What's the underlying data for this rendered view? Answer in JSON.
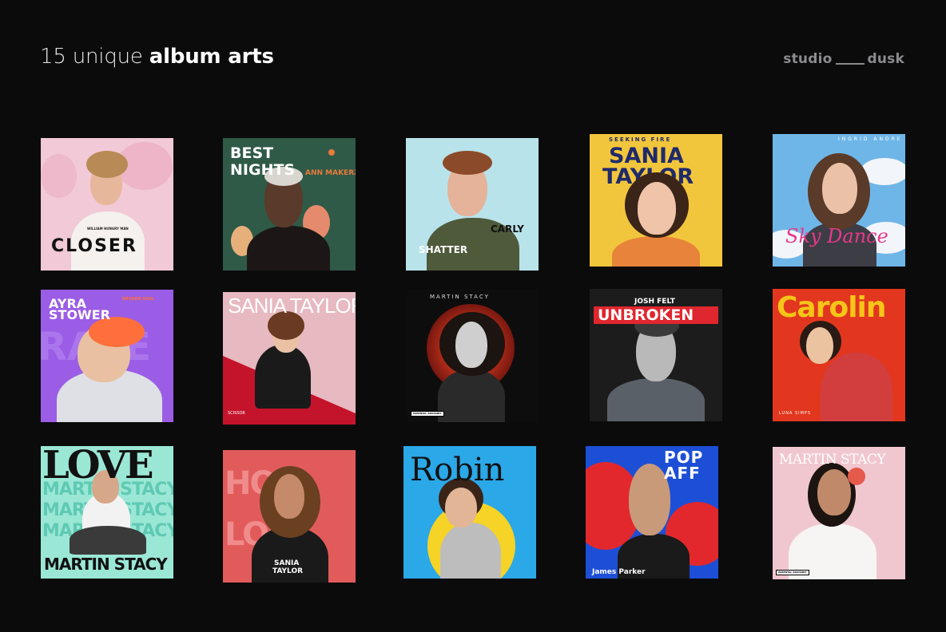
{
  "header": {
    "title_light": "15 unique ",
    "title_bold": "album arts",
    "brand_left": "studio",
    "brand_right": "dusk"
  },
  "covers": [
    {
      "id": 1,
      "texts": {
        "main": "CLOSER",
        "small": "WILLIAM HUNGRY MAN"
      },
      "colors": {
        "bg": "#f2c9d6"
      }
    },
    {
      "id": 2,
      "texts": {
        "l1": "BEST",
        "l2": "NIGHTS",
        "artist": "ANN MAKERZ"
      },
      "colors": {
        "bg": "#2f5a47",
        "accent": "#e87a3c"
      }
    },
    {
      "id": 3,
      "texts": {
        "a": "CARLY",
        "b": "SHATTER"
      },
      "colors": {
        "bg": "#b9e3ea"
      }
    },
    {
      "id": 4,
      "texts": {
        "top": "SEEKING FIRE",
        "l1": "SANIA",
        "l2": "TAYLOR"
      },
      "colors": {
        "bg": "#f2c63c",
        "text": "#1f2a6b"
      }
    },
    {
      "id": 5,
      "texts": {
        "top": "INGRID ANDRE",
        "script": "Sky Dance"
      },
      "colors": {
        "bg": "#6fb6e8",
        "script": "#e63a8a"
      }
    },
    {
      "id": 6,
      "texts": {
        "l1": "AYRA",
        "l2": "STOWER",
        "tag": "BROKEN SOUL"
      },
      "colors": {
        "bg": "#9b5de5",
        "accent": "#ff6f3c"
      }
    },
    {
      "id": 7,
      "texts": {
        "main": "SANIA TAYLOR",
        "small": "SCISSOR"
      },
      "colors": {
        "bg": "#e7b9c0",
        "accent": "#c4142c"
      }
    },
    {
      "id": 8,
      "texts": {
        "top": "MARTIN STACY",
        "label": "PARENTAL ADVISORY"
      },
      "colors": {
        "bg": "#0d0d0d",
        "accent": "#d23a1e"
      }
    },
    {
      "id": 9,
      "texts": {
        "top": "JOSH FELT",
        "main": "UNBROKEN"
      },
      "colors": {
        "bg": "#1c1c1c",
        "accent": "#e0262e"
      }
    },
    {
      "id": 10,
      "texts": {
        "main": "Carolin",
        "small": "LUNA SIMPS"
      },
      "colors": {
        "bg": "#e2371e",
        "text": "#f5c518"
      }
    },
    {
      "id": 11,
      "texts": {
        "big": "LOVE",
        "rep": "MARTIN STACY"
      },
      "colors": {
        "bg": "#9be7d6"
      }
    },
    {
      "id": 12,
      "texts": {
        "big": "HOT LOVE",
        "l1": "SANIA",
        "l2": "TAYLOR"
      },
      "colors": {
        "bg": "#e25b5b"
      }
    },
    {
      "id": 13,
      "texts": {
        "main": "Robin"
      },
      "colors": {
        "bg": "#2ba8e8",
        "circle": "#f5d327"
      }
    },
    {
      "id": 14,
      "texts": {
        "pop": "POP",
        "aff": "AFF",
        "name": "James Parker"
      },
      "colors": {
        "bg": "#1d4fd6",
        "accent": "#e2282c"
      }
    },
    {
      "id": 15,
      "texts": {
        "top": "MARTIN STACY",
        "label": "PARENTAL ADVISORY"
      },
      "colors": {
        "bg": "#f1c7cf"
      }
    }
  ]
}
